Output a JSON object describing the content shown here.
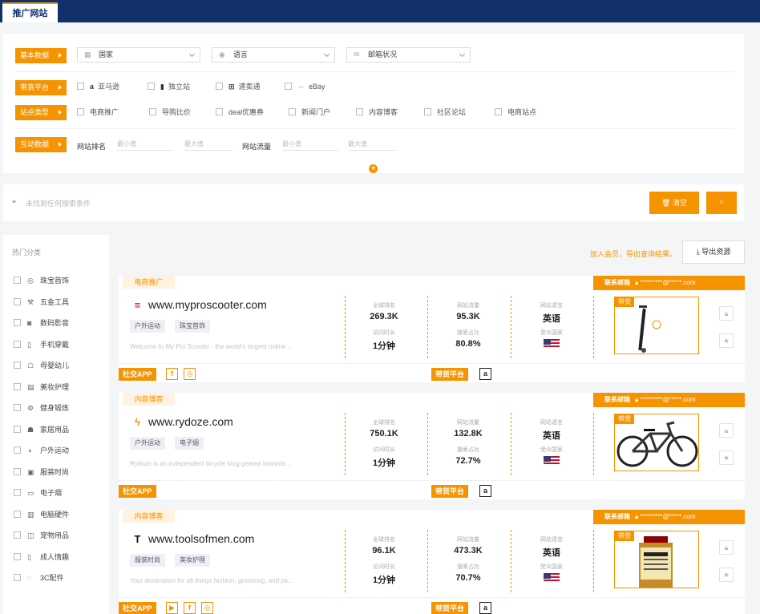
{
  "header": {
    "tab_label": "推广网站"
  },
  "filters": {
    "basic": {
      "label": "基本数据",
      "dropdowns": [
        {
          "value": "国家",
          "icon": "building-icon"
        },
        {
          "value": "语言",
          "icon": "globe-icon"
        },
        {
          "value": "邮箱状况",
          "icon": "envelope-icon"
        }
      ]
    },
    "platform": {
      "label": "带货平台",
      "options": [
        "亚马逊",
        "独立站",
        "速卖通",
        "eBay"
      ]
    },
    "site_type": {
      "label": "站点类型",
      "options": [
        "电商推广",
        "导购比价",
        "deal优惠券",
        "新闻门户",
        "内容博客",
        "社区论坛",
        "电商站点"
      ]
    },
    "interact": {
      "label": "互动数据",
      "rank_label": "网站排名",
      "traffic_label": "网站流量",
      "min_placeholder": "最小值",
      "max_placeholder": "最大值"
    },
    "expand_icon": "+"
  },
  "search": {
    "placeholder": "未找到任何搜索条件",
    "clear_label": "清空",
    "search_icon": "search-icon"
  },
  "sidebar": {
    "title": "热门分类",
    "categories": [
      {
        "label": "珠宝首饰",
        "icon": "◎"
      },
      {
        "label": "五金工具",
        "icon": "⚒"
      },
      {
        "label": "数码影音",
        "icon": "◙"
      },
      {
        "label": "手机穿戴",
        "icon": "▯"
      },
      {
        "label": "母婴幼儿",
        "icon": "☖"
      },
      {
        "label": "美妆护理",
        "icon": "▤"
      },
      {
        "label": "健身锻炼",
        "icon": "⚙"
      },
      {
        "label": "家居用品",
        "icon": "☗"
      },
      {
        "label": "户外运动",
        "icon": "◑"
      },
      {
        "label": "服装时尚",
        "icon": "▣"
      },
      {
        "label": "电子烟",
        "icon": "▭"
      },
      {
        "label": "电脑硬件",
        "icon": "▥"
      },
      {
        "label": "宠物用品",
        "icon": "◫"
      },
      {
        "label": "成人情趣",
        "icon": "▯"
      },
      {
        "label": "3C配件",
        "icon": "◌"
      }
    ]
  },
  "results": {
    "export_note": "加入会员，导出查询结果。",
    "export_label": "导出资源",
    "labels": {
      "rank": "全球排名",
      "traffic": "网站流量",
      "language": "网站语言",
      "visit": "访问时长",
      "search_share": "搜索占比",
      "region": "受众国家",
      "product_badge": "带货",
      "social": "社交APP",
      "platform": "带货平台",
      "email_label": "联系邮箱"
    },
    "cards": [
      {
        "type": "电商推广",
        "email": "*********@*****.com",
        "logo": "≡",
        "logo_color": "#d0021b",
        "url": "www.myproscooter.com",
        "tags": [
          "户外运动",
          "珠宝首饰"
        ],
        "desc": "Welcome to My Pro Scooter - the world's largest online ...",
        "rank": "269.3K",
        "traffic": "95.3K",
        "language": "英语",
        "visit": "1分钟",
        "search_share": "80.8%",
        "product": "scooter",
        "socials": [
          "f",
          "◎"
        ]
      },
      {
        "type": "内容博客",
        "email": "*********@*****.com",
        "logo": "ϟ",
        "logo_color": "#f59300",
        "url": "www.rydoze.com",
        "tags": [
          "户外运动",
          "电子烟"
        ],
        "desc": "Rydoze is an independent bicycle blog geared towards ...",
        "rank": "750.1K",
        "traffic": "132.8K",
        "language": "英语",
        "visit": "1分钟",
        "search_share": "72.7%",
        "product": "bicycle",
        "socials": []
      },
      {
        "type": "内容博客",
        "email": "*********@*****.com",
        "logo": "T",
        "logo_color": "#111111",
        "url": "www.toolsofmen.com",
        "tags": [
          "服装时尚",
          "美妆护理"
        ],
        "desc": "Your destination for all things fashion, grooming, and pe...",
        "rank": "96.1K",
        "traffic": "473.3K",
        "language": "英语",
        "visit": "1分钟",
        "search_share": "70.7%",
        "product": "bottle",
        "socials": [
          "▶",
          "f",
          "◎"
        ]
      }
    ]
  }
}
